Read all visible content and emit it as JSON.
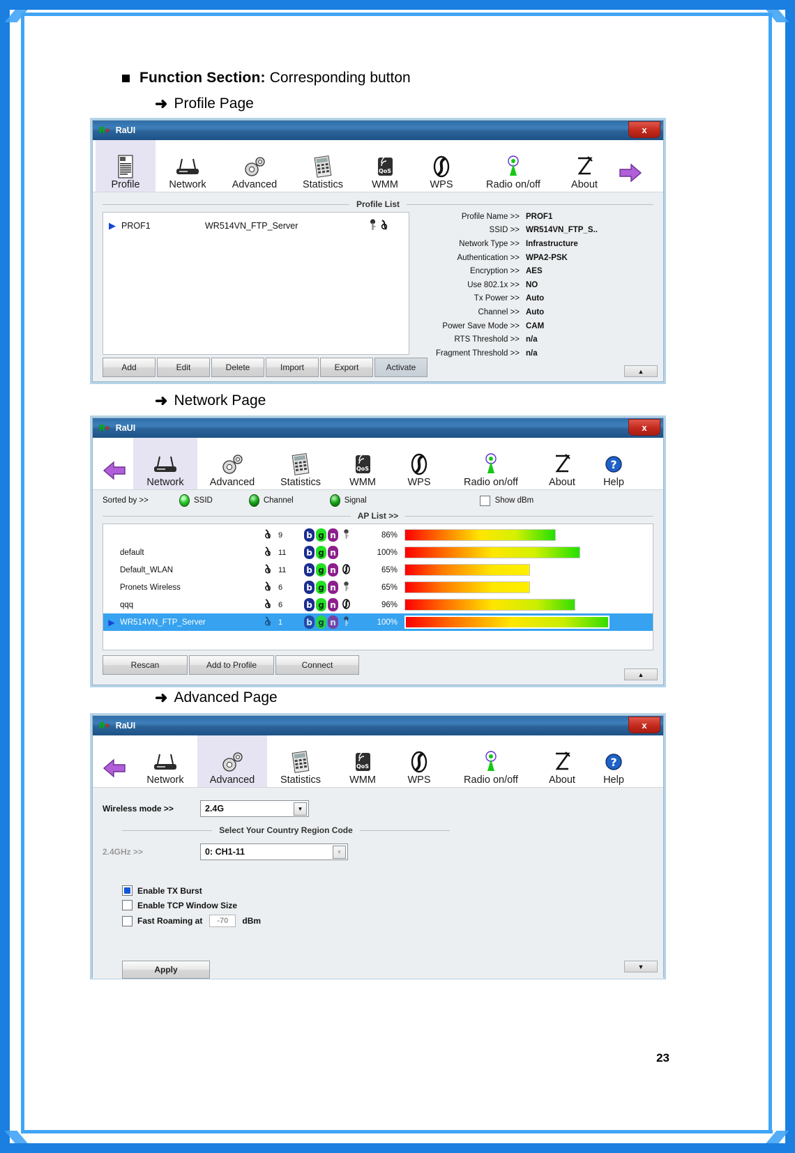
{
  "document": {
    "heading_bold": "Function Section:",
    "heading_rest": "Corresponding button",
    "section_1": "Profile Page",
    "section_2": "Network Page",
    "section_3": "Advanced Page",
    "page_number": "23"
  },
  "window_profile": {
    "title": "RaUI",
    "logo": "R",
    "close_label": "x",
    "tabs": [
      {
        "label": "Profile",
        "icon": "profile-icon",
        "active": true
      },
      {
        "label": "Network",
        "icon": "network-router-icon",
        "active": false
      },
      {
        "label": "Advanced",
        "icon": "gears-icon",
        "active": false
      },
      {
        "label": "Statistics",
        "icon": "calculator-icon",
        "active": false
      },
      {
        "label": "WMM",
        "icon": "qos-signal-icon",
        "active": false
      },
      {
        "label": "WPS",
        "icon": "wps-icon",
        "active": false
      },
      {
        "label": "Radio on/off",
        "icon": "radio-antenna-icon",
        "active": false
      },
      {
        "label": "About",
        "icon": "about-icon",
        "active": false
      },
      {
        "label": "Next",
        "icon": "arrow-right-icon",
        "active": false
      }
    ],
    "group_title": "Profile List",
    "rows": [
      {
        "name": "PROF1",
        "ssid": "WR514VN_FTP_Server",
        "icons": "lock-key-icon wifi-icon"
      }
    ],
    "buttons": [
      "Add",
      "Edit",
      "Delete",
      "Import",
      "Export",
      "Activate"
    ],
    "details": [
      {
        "key": "Profile Name >>",
        "value": "PROF1"
      },
      {
        "key": "SSID >>",
        "value": "WR514VN_FTP_S.."
      },
      {
        "key": "Network Type >>",
        "value": "Infrastructure"
      },
      {
        "key": "Authentication >>",
        "value": "WPA2-PSK"
      },
      {
        "key": "Encryption >>",
        "value": "AES"
      },
      {
        "key": "Use 802.1x >>",
        "value": "NO"
      },
      {
        "key": "Tx Power >>",
        "value": "Auto"
      },
      {
        "key": "Channel >>",
        "value": "Auto"
      },
      {
        "key": "Power Save Mode >>",
        "value": "CAM"
      },
      {
        "key": "RTS Threshold >>",
        "value": "n/a"
      },
      {
        "key": "Fragment Threshold >>",
        "value": "n/a"
      }
    ],
    "corner_arrow": "▲"
  },
  "window_network": {
    "title": "RaUI",
    "logo": "R",
    "close_label": "x",
    "tabs": [
      {
        "label": "",
        "icon": "arrow-left-icon",
        "active": false
      },
      {
        "label": "Network",
        "icon": "network-router-icon",
        "active": true
      },
      {
        "label": "Advanced",
        "icon": "gears-icon",
        "active": false
      },
      {
        "label": "Statistics",
        "icon": "calculator-icon",
        "active": false
      },
      {
        "label": "WMM",
        "icon": "qos-signal-icon",
        "active": false
      },
      {
        "label": "WPS",
        "icon": "wps-icon",
        "active": false
      },
      {
        "label": "Radio on/off",
        "icon": "radio-antenna-icon",
        "active": false
      },
      {
        "label": "About",
        "icon": "about-icon",
        "active": false
      },
      {
        "label": "Help",
        "icon": "help-question-icon",
        "active": false
      }
    ],
    "sorted_by_label": "Sorted by >>",
    "sort_options": [
      "SSID",
      "Channel",
      "Signal"
    ],
    "show_dbm_label": "Show dBm",
    "show_dbm_checked": false,
    "ap_list_title": "AP List >>",
    "ap_rows": [
      {
        "ssid": "",
        "channel": "9",
        "badges": [
          "b",
          "g",
          "n"
        ],
        "security": "key",
        "signal": "86%",
        "signal_pct": 86,
        "selected": false
      },
      {
        "ssid": "default",
        "channel": "11",
        "badges": [
          "b",
          "g",
          "n"
        ],
        "security": "",
        "signal": "100%",
        "signal_pct": 100,
        "selected": false
      },
      {
        "ssid": "Default_WLAN",
        "channel": "11",
        "badges": [
          "b",
          "g",
          "n"
        ],
        "security": "wps",
        "signal": "65%",
        "signal_pct": 65,
        "selected": false
      },
      {
        "ssid": "Pronets Wireless",
        "channel": "6",
        "badges": [
          "b",
          "g",
          "n"
        ],
        "security": "key",
        "signal": "65%",
        "signal_pct": 65,
        "selected": false
      },
      {
        "ssid": "qqq",
        "channel": "6",
        "badges": [
          "b",
          "g",
          "n"
        ],
        "security": "wps",
        "signal": "96%",
        "signal_pct": 96,
        "selected": false
      },
      {
        "ssid": "WR514VN_FTP_Server",
        "channel": "1",
        "badges": [
          "b",
          "g",
          "n"
        ],
        "security": "key",
        "signal": "100%",
        "signal_pct": 100,
        "selected": true
      }
    ],
    "buttons": [
      "Rescan",
      "Add to Profile",
      "Connect"
    ],
    "corner_arrow": "▲"
  },
  "window_advanced": {
    "title": "RaUI",
    "logo": "R",
    "close_label": "x",
    "tabs": [
      {
        "label": "",
        "icon": "arrow-left-icon",
        "active": false
      },
      {
        "label": "Network",
        "icon": "network-router-icon",
        "active": false
      },
      {
        "label": "Advanced",
        "icon": "gears-icon",
        "active": true
      },
      {
        "label": "Statistics",
        "icon": "calculator-icon",
        "active": false
      },
      {
        "label": "WMM",
        "icon": "qos-signal-icon",
        "active": false
      },
      {
        "label": "WPS",
        "icon": "wps-icon",
        "active": false
      },
      {
        "label": "Radio on/off",
        "icon": "radio-antenna-icon",
        "active": false
      },
      {
        "label": "About",
        "icon": "about-icon",
        "active": false
      },
      {
        "label": "Help",
        "icon": "help-question-icon",
        "active": false
      }
    ],
    "wireless_mode_label": "Wireless mode >>",
    "wireless_mode_value": "2.4G",
    "region_group_title": "Select Your Country Region Code",
    "region_label": "2.4GHz >>",
    "region_value": "0: CH1-11",
    "checkboxes": [
      {
        "label": "Enable TX Burst",
        "checked": true
      },
      {
        "label": "Enable TCP Window Size",
        "checked": false
      },
      {
        "label": "Fast Roaming at",
        "checked": false
      }
    ],
    "fast_roaming_value": "-70",
    "fast_roaming_unit": "dBm",
    "apply_label": "Apply",
    "corner_arrow": "▼"
  },
  "colors": {
    "accent_blue": "#1a7fe0",
    "selection_blue": "#36a2f0",
    "title_blue": "#2f6ea8",
    "close_red": "#c32a1d",
    "led_green": "#2ecb2e"
  }
}
